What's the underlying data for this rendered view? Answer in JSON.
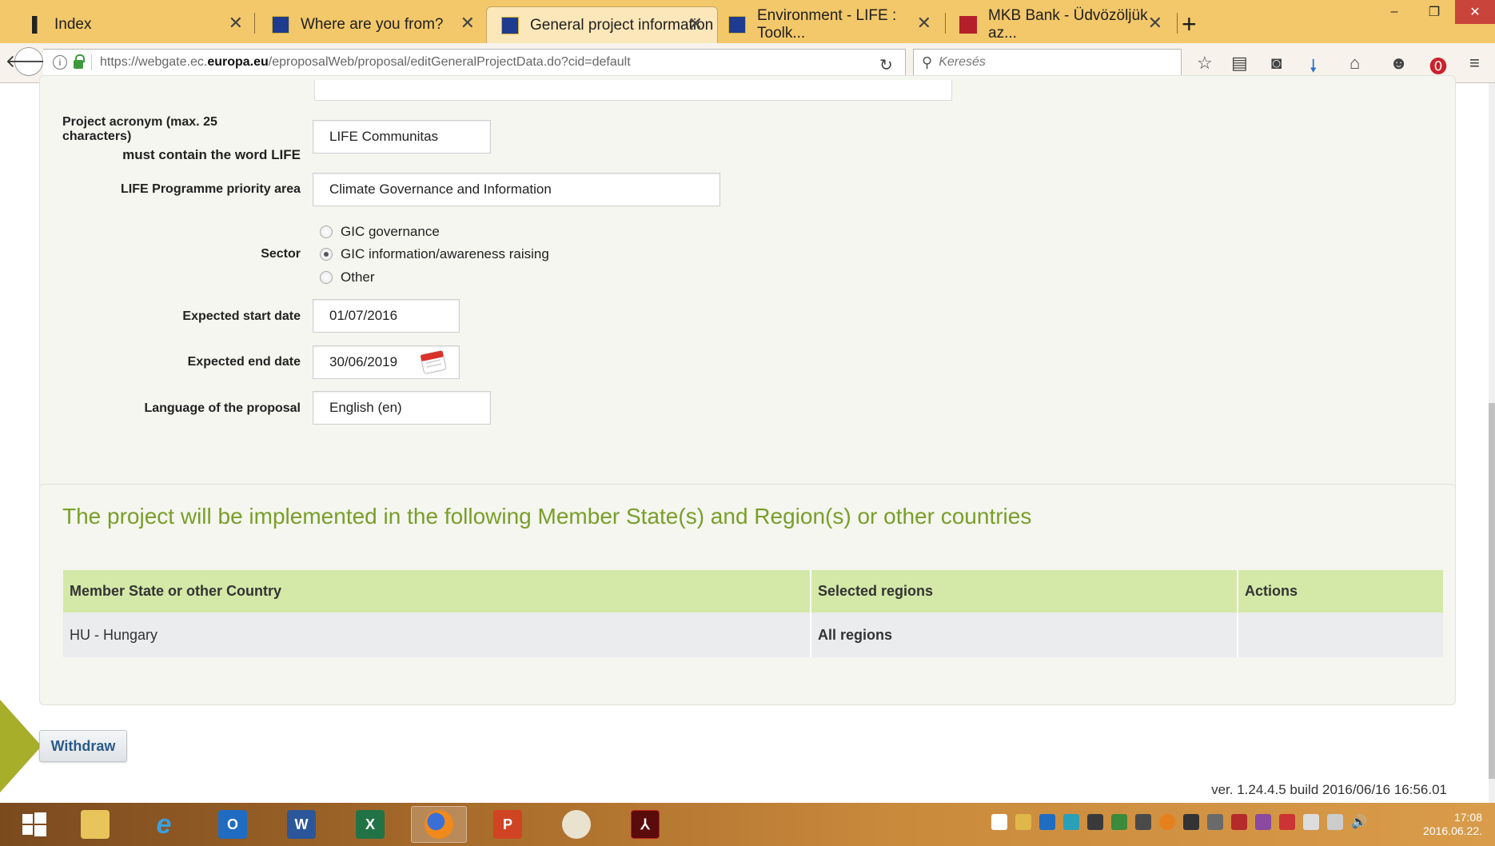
{
  "browser": {
    "tabs": [
      {
        "title": "Index",
        "active": false
      },
      {
        "title": "Where are you from?",
        "active": false
      },
      {
        "title": "General project information",
        "active": true
      },
      {
        "title": "Environment - LIFE : Toolk...",
        "active": false
      },
      {
        "title": "MKB Bank - Üdvözöljük az...",
        "active": false
      }
    ],
    "url_prefix": "https://webgate.ec.",
    "url_domain": "europa.eu",
    "url_suffix": "/eproposalWeb/proposal/editGeneralProjectData.do?cid=default",
    "search_placeholder": "Keresés"
  },
  "form": {
    "acronym_label_line1": "Project acronym (max. 25",
    "acronym_label_line2": "characters)",
    "acronym_label_line3": "must contain the word LIFE",
    "acronym_value": "LIFE Communitas",
    "priority_label": "LIFE Programme priority area",
    "priority_value": "Climate Governance and Information",
    "sector_label": "Sector",
    "sector_options": [
      {
        "label": "GIC governance",
        "checked": false
      },
      {
        "label": "GIC information/awareness raising",
        "checked": true
      },
      {
        "label": "Other",
        "checked": false
      }
    ],
    "start_label": "Expected start date",
    "start_value": "01/07/2016",
    "end_label": "Expected end date",
    "end_value": "30/06/2019",
    "language_label": "Language of the proposal",
    "language_value": "English (en)"
  },
  "implementation": {
    "title": "The project will be implemented in the following Member State(s) and Region(s) or other countries",
    "columns": [
      "Member State or other Country",
      "Selected regions",
      "Actions"
    ],
    "rows": [
      {
        "country": "HU - Hungary",
        "regions": "All regions",
        "actions": ""
      }
    ]
  },
  "withdraw_label": "Withdraw",
  "version_text": "ver. 1.24.4.5 build 2016/06/16 16:56.01",
  "taskbar": {
    "time": "17:08",
    "date": "2016.06.22."
  },
  "colors": {
    "tabbar_bg": "#f3c86a",
    "section_title": "#7a9e2a",
    "table_header": "#d4e8a8",
    "arrow": "#a7ae2a"
  }
}
